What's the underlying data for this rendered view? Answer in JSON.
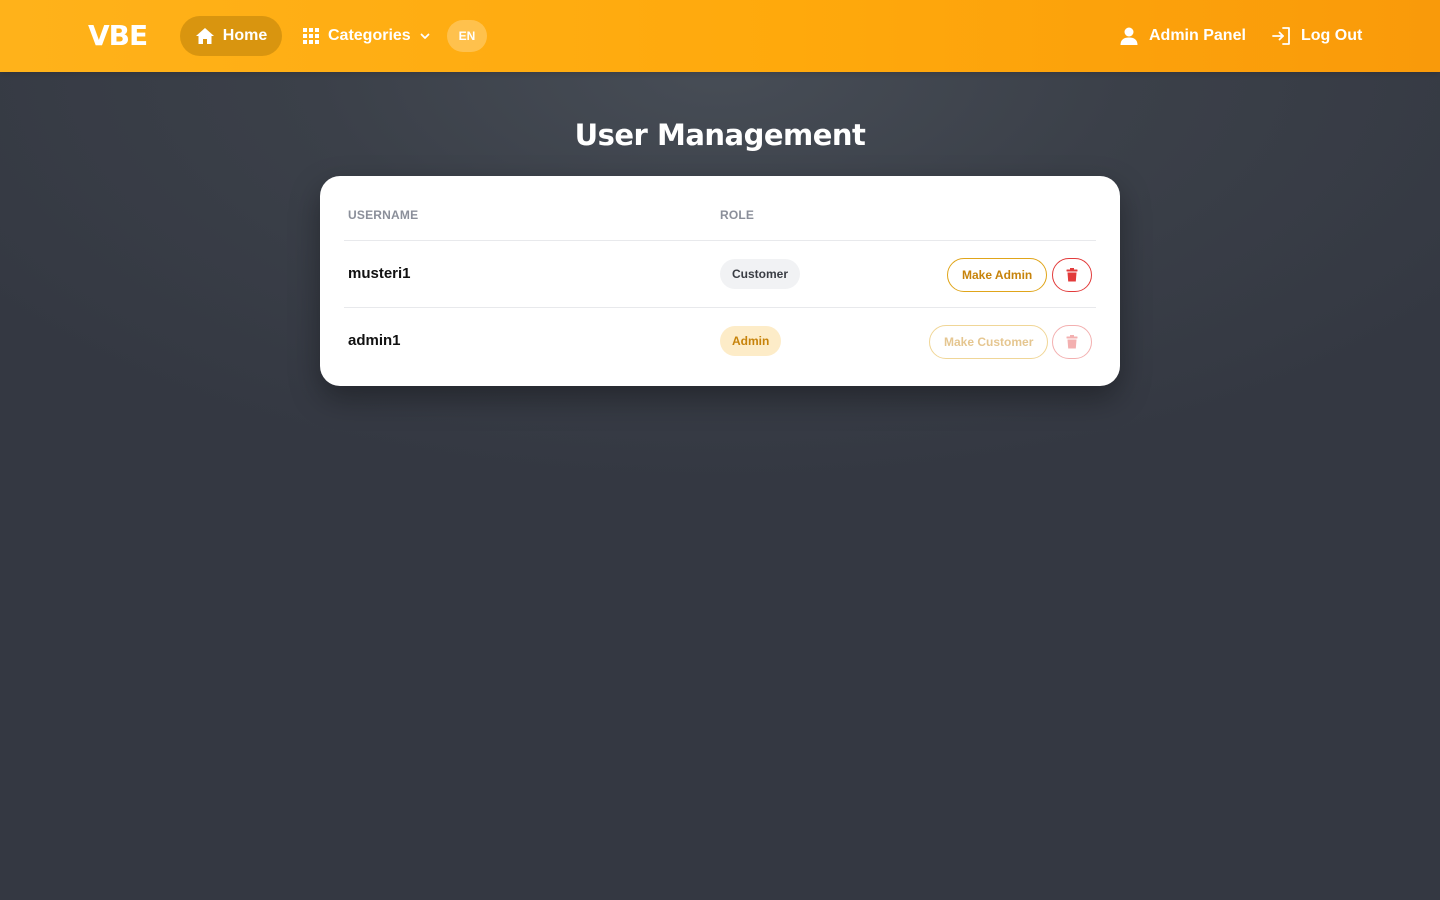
{
  "header": {
    "logo": "VBE",
    "home_label": "Home",
    "categories_label": "Categories",
    "language": "EN",
    "admin_panel_label": "Admin Panel",
    "logout_label": "Log Out"
  },
  "page": {
    "title": "User Management"
  },
  "table": {
    "columns": [
      "USERNAME",
      "ROLE"
    ],
    "rows": [
      {
        "username": "musteri1",
        "role": "Customer",
        "action_label": "Make Admin",
        "actions_enabled": true
      },
      {
        "username": "admin1",
        "role": "Admin",
        "action_label": "Make Customer",
        "actions_enabled": false
      }
    ]
  },
  "icons": {
    "home": "home-icon",
    "categories": "grid-icon",
    "dropdown": "chevron-down-icon",
    "admin": "user-icon",
    "logout": "logout-icon",
    "delete": "trash-icon"
  },
  "colors": {
    "header_start": "#ffb21a",
    "header_end": "#f99a0a",
    "accent": "#e0a51a",
    "danger": "#e23b3b",
    "background": "#3b4049"
  }
}
